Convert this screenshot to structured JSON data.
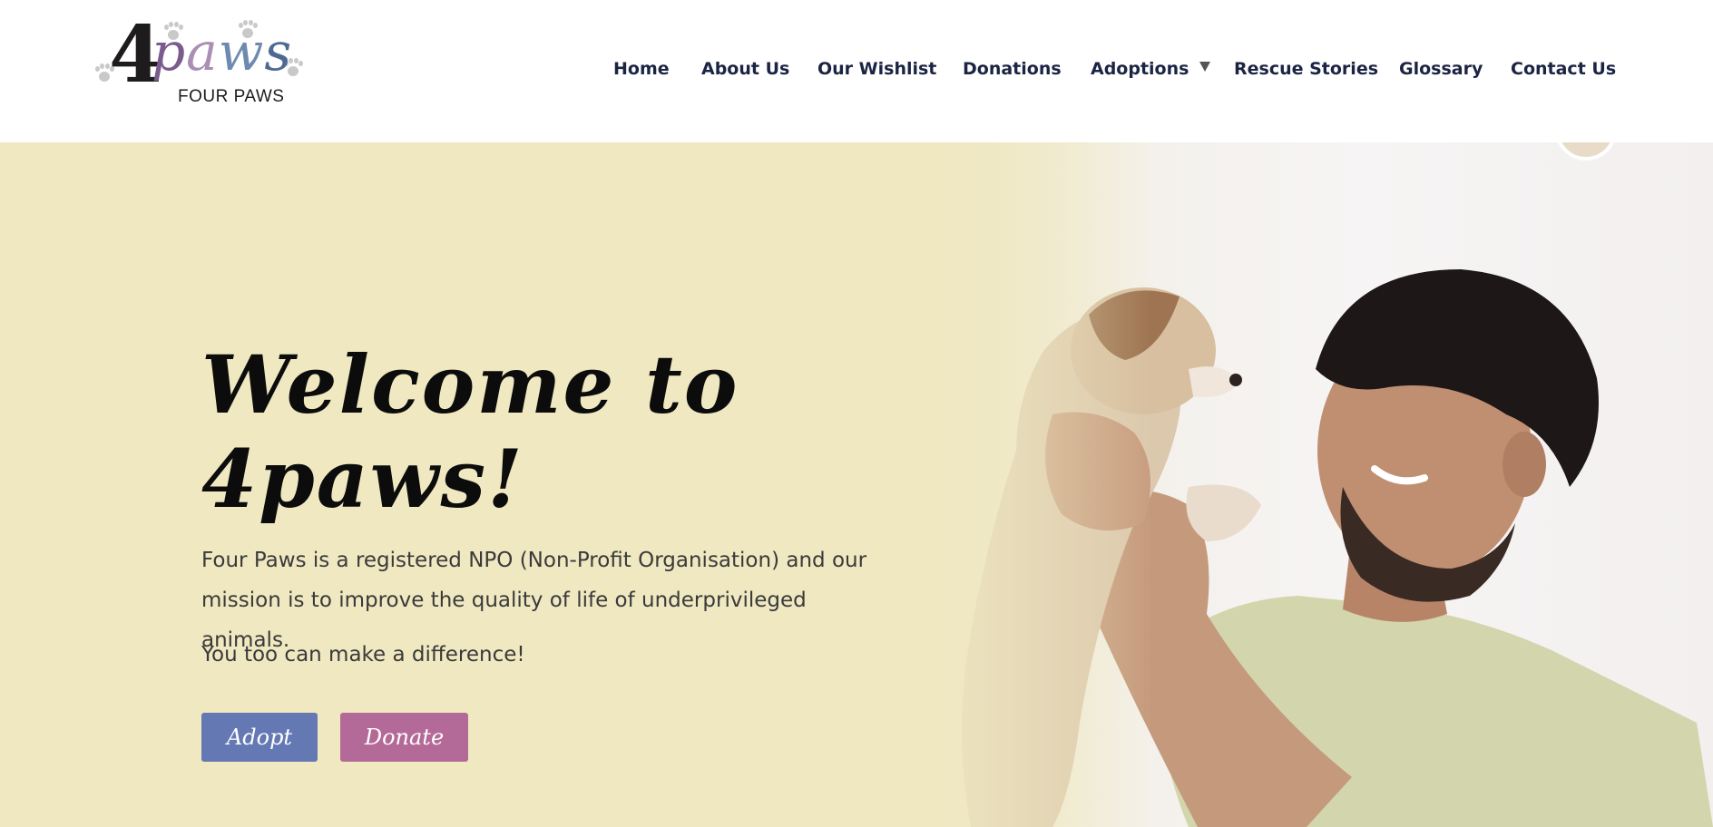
{
  "logo": {
    "number": "4",
    "word": "paws",
    "subtitle": "FOUR PAWS"
  },
  "nav": {
    "home": "Home",
    "about": "About Us",
    "wishlist": "Our Wishlist",
    "donations": "Donations",
    "adoptions": "Adoptions",
    "rescue": "Rescue Stories",
    "glossary": "Glossary",
    "contact": "Contact Us"
  },
  "hero": {
    "title_line1": "Welcome to",
    "title_line2": "4paws!",
    "description": "Four Paws is a registered NPO (Non-Profit Organisation) and our mission is to improve the quality of life of underprivileged animals.",
    "tagline": "You too can make a difference!",
    "adopt_label": "Adopt",
    "donate_label": "Donate",
    "image_description": "Smiling man holding up a puppy"
  },
  "colors": {
    "hero_background": "#efe8c1",
    "nav_text": "#1b2443",
    "adopt_button": "#6478b4",
    "donate_button": "#b46a98"
  }
}
